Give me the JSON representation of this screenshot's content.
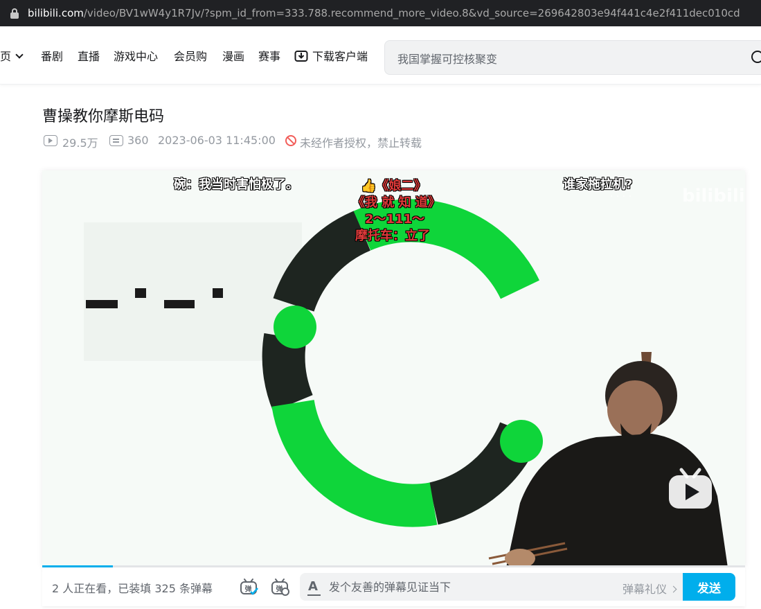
{
  "browser": {
    "url_host": "bilibili.com",
    "url_path": "/video/BV1wW4y1R7Jv/?spm_id_from=333.788.recommend_more_video.8&vd_source=269642803e94f441c4e2f411dec010cd"
  },
  "nav": {
    "home_label": "页",
    "items": [
      "番剧",
      "直播",
      "游戏中心",
      "会员购",
      "漫画",
      "赛事"
    ],
    "download_label": "下载客户端",
    "search_placeholder": "我国掌握可控核聚变"
  },
  "video": {
    "title": "曹操教你摩斯电码",
    "views": "29.5万",
    "danmaku_count": "360",
    "date": "2023-06-03 11:45:00",
    "copyright_notice": "未经作者授权，禁止转载",
    "watermark": "bilibili",
    "progress": 0.1,
    "danmaku": [
      {
        "text": "碗：我当时害怕极了。",
        "color": "#ffffff"
      },
      {
        "text": "👍《娘二》",
        "color": "#e03a3a"
      },
      {
        "text": "《我 就 知 道》",
        "color": "#e03a3a"
      },
      {
        "text": "2～111～",
        "color": "#e03a3a"
      },
      {
        "text": "摩托车：立了",
        "color": "#e03a3a"
      },
      {
        "text": "谁家拖拉机?",
        "color": "#ffffff"
      }
    ]
  },
  "sendbar": {
    "viewers_text": "2 人正在看，已装填 325 条弹幕",
    "input_placeholder": "发个友善的弹幕见证当下",
    "etiquette_label": "弹幕礼仪",
    "send_label": "发送",
    "accent_color": "#00aeec"
  }
}
